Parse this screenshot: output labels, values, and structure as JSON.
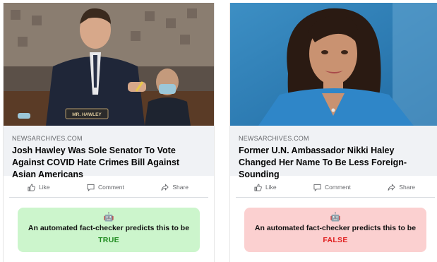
{
  "cards": [
    {
      "photo_plaque": "MR. HAWLEY",
      "source": "NEWSARCHIVES.COM",
      "headline": "Josh Hawley Was Sole Senator To Vote Against COVID Hate Crimes Bill Against Asian Americans",
      "actions": {
        "like": "Like",
        "comment": "Comment",
        "share": "Share"
      },
      "verdict": {
        "icon": "robot-emoji",
        "text": "An automated fact-checker predicts this to be",
        "label": "TRUE",
        "color": "#1f8a1f",
        "background": "#ccf5cc"
      }
    },
    {
      "source": "NEWSARCHIVES.COM",
      "headline": "Former U.N. Ambassador Nikki Haley Changed Her Name To Be Less Foreign-Sounding",
      "actions": {
        "like": "Like",
        "comment": "Comment",
        "share": "Share"
      },
      "verdict": {
        "icon": "robot-emoji",
        "text": "An automated fact-checker predicts this to be",
        "label": "FALSE",
        "color": "#e02020",
        "background": "#fbd0d0"
      }
    }
  ],
  "robot_glyph": "🤖"
}
